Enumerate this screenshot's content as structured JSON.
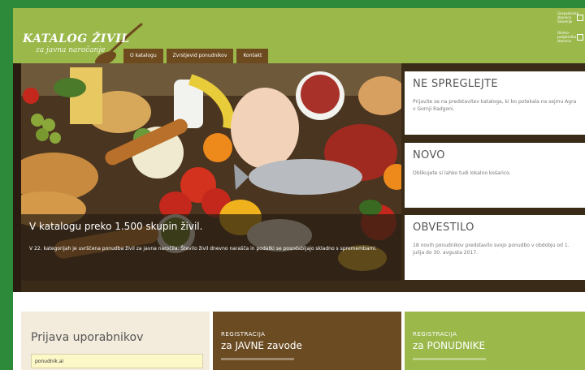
{
  "header": {
    "logo_title": "KATALOG ŽIVIL",
    "logo_subtitle": "za javna naročanje",
    "nav": [
      "O katalogu",
      "Zvrstjevid ponudnikov",
      "Kontakt"
    ],
    "gov_lines": [
      "Gospodarska",
      "zbornica",
      "Slovenije",
      "Obrtno-",
      "podjetniška",
      "zbornica"
    ]
  },
  "hero": {
    "caption_title": "V katalogu preko 1.500 skupin živil.",
    "caption_text": "V 22. kategorijah je uvrščena ponudba živil za javna naročila. Število živil dnevno narašča in podatki se posodabljajo skladno s spremembami."
  },
  "news": [
    {
      "title": "NE SPREGLEJTE",
      "text": "Prijavite se na predstavitev kataloga, ki bo potekala na sejmu Agra v Gornji Radgoni."
    },
    {
      "title": "NOVO",
      "text": "Oblikujete si lahko tudi lokalno košarico."
    },
    {
      "title": "OBVESTILO",
      "text": "18 novih ponudnikov predstavilo svojo ponudbo v obdobju od 1. julija do 30. avgusta 2017."
    }
  ],
  "login": {
    "title": "Prijava uporabnikov",
    "input_value": "ponudnik.ai"
  },
  "register": [
    {
      "small": "REGISTRACIJA",
      "big": "za JAVNE zavode"
    },
    {
      "small": "REGISTRACIJA",
      "big": "za PONUDNIKE"
    }
  ],
  "colors": {
    "frame": "#2d8a3a",
    "header": "#9bb84b",
    "nav": "#6e4a1f",
    "brown": "#6b4b22"
  }
}
